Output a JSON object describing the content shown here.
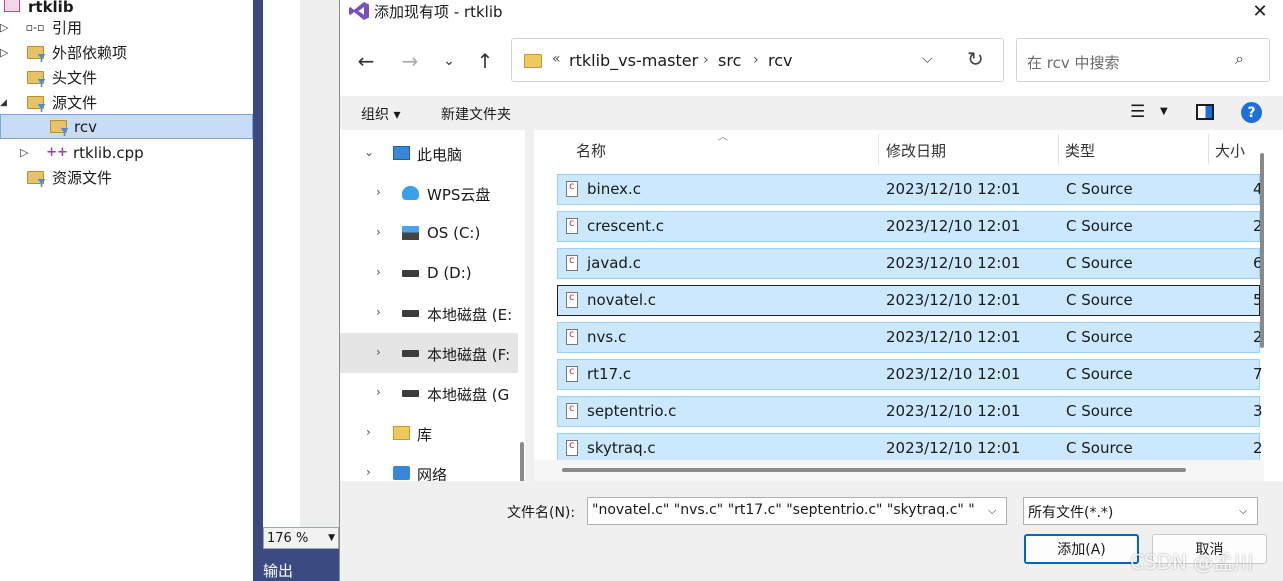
{
  "solution": {
    "project": "rtklib",
    "items": [
      {
        "label": "引用",
        "icon": "references-icon"
      },
      {
        "label": "外部依赖项",
        "icon": "external-deps-icon"
      },
      {
        "label": "头文件",
        "icon": "filter-folder-icon"
      },
      {
        "label": "源文件",
        "icon": "filter-folder-icon"
      },
      {
        "label": "rcv",
        "icon": "filter-folder-icon"
      },
      {
        "label": "rtklib.cpp",
        "icon": "cpp-file-icon"
      },
      {
        "label": "资源文件",
        "icon": "filter-folder-icon"
      }
    ],
    "zoom": "176 %",
    "output_tab": "输出"
  },
  "dialog": {
    "title": "添加现有项 - rtklib",
    "address": {
      "overflow": "«",
      "crumbs": [
        "rtklib_vs-master",
        "src",
        "rcv"
      ]
    },
    "search_placeholder": "在 rcv 中搜索",
    "toolbar": {
      "organize": "组织 ▾",
      "new_folder": "新建文件夹",
      "help": "?"
    },
    "nav": [
      {
        "label": "此电脑",
        "expanded": true
      },
      {
        "label": "WPS云盘"
      },
      {
        "label": "OS (C:)"
      },
      {
        "label": "D (D:)"
      },
      {
        "label": "本地磁盘 (E:"
      },
      {
        "label": "本地磁盘 (F:"
      },
      {
        "label": "本地磁盘 (G"
      },
      {
        "label": "库"
      },
      {
        "label": "网络"
      }
    ],
    "columns": {
      "name": "名称",
      "date": "修改日期",
      "type": "类型",
      "size": "大小"
    },
    "files": [
      {
        "name": "binex.c",
        "date": "2023/12/10 12:01",
        "type": "C Source",
        "size": "4"
      },
      {
        "name": "crescent.c",
        "date": "2023/12/10 12:01",
        "type": "C Source",
        "size": "2"
      },
      {
        "name": "javad.c",
        "date": "2023/12/10 12:01",
        "type": "C Source",
        "size": "6"
      },
      {
        "name": "novatel.c",
        "date": "2023/12/10 12:01",
        "type": "C Source",
        "size": "5"
      },
      {
        "name": "nvs.c",
        "date": "2023/12/10 12:01",
        "type": "C Source",
        "size": "2"
      },
      {
        "name": "rt17.c",
        "date": "2023/12/10 12:01",
        "type": "C Source",
        "size": "7"
      },
      {
        "name": "septentrio.c",
        "date": "2023/12/10 12:01",
        "type": "C Source",
        "size": "3"
      },
      {
        "name": "skytraq.c",
        "date": "2023/12/10 12:01",
        "type": "C Source",
        "size": "2"
      }
    ],
    "filename_label": "文件名(N):",
    "filename_value": "\"novatel.c\" \"nvs.c\" \"rt17.c\" \"septentrio.c\" \"skytraq.c\" \"",
    "filter_value": "所有文件(*.*)",
    "add_button": "添加(A)",
    "cancel_button": "取消"
  },
  "watermark": "CSDN @孟川"
}
